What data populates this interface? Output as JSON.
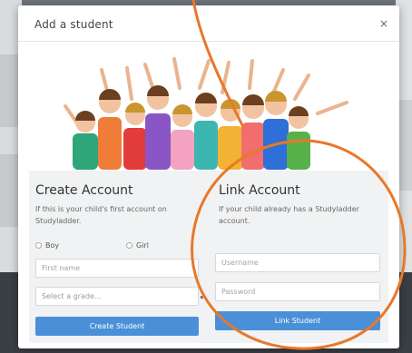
{
  "modal": {
    "title": "Add a student",
    "close_glyph": "×"
  },
  "hero_image": {
    "icon": "children-group-photo"
  },
  "create_account": {
    "title": "Create Account",
    "description": "If this is your child's first account on Studyladder.",
    "radio_boy": "Boy",
    "radio_girl": "Girl",
    "first_name_placeholder": "First name",
    "grade_select_value": "Select a grade...",
    "button": "Create Student"
  },
  "link_account": {
    "title": "Link Account",
    "description": "If your child already has a Studyladder account.",
    "username_placeholder": "Username",
    "password_placeholder": "Password",
    "button": "Link Student"
  },
  "colors": {
    "button_blue": "#4a90d9",
    "annotation_orange": "#e8782a",
    "panel_bg": "#f1f2f3"
  }
}
